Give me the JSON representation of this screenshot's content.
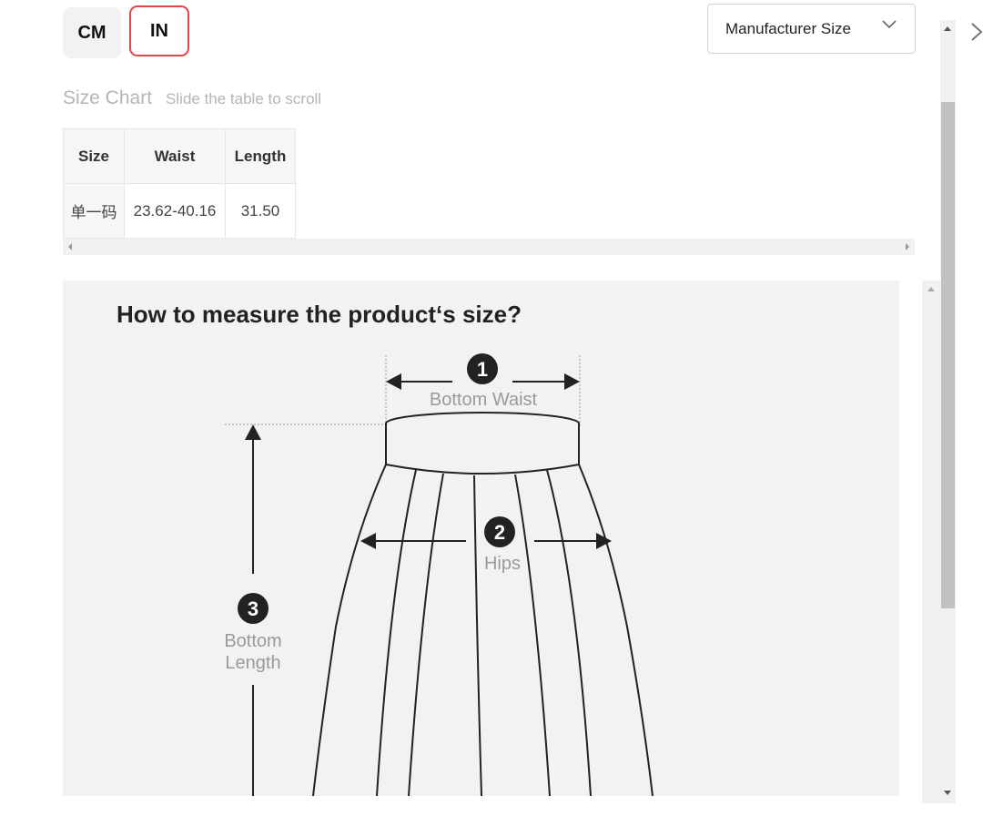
{
  "units": {
    "cm_label": "CM",
    "in_label": "IN",
    "selected": "IN"
  },
  "size_type_dropdown": {
    "value": "Manufacturer Size"
  },
  "size_chart": {
    "title": "Size Chart",
    "hint": "Slide the table to scroll",
    "columns": [
      "Size",
      "Waist",
      "Length"
    ],
    "rows": [
      [
        "单一码",
        "23.62-40.16",
        "31.50"
      ]
    ]
  },
  "measure_guide": {
    "title": "How to measure the product‘s size?",
    "items": [
      {
        "number": "1",
        "label": "Bottom Waist"
      },
      {
        "number": "2",
        "label": "Hips"
      },
      {
        "number": "3",
        "label_line1": "Bottom",
        "label_line2": "Length"
      }
    ]
  },
  "colors": {
    "accent": "#e0474c",
    "muted_text": "#b5b5b5",
    "diagram_bg": "#f2f2f2"
  }
}
